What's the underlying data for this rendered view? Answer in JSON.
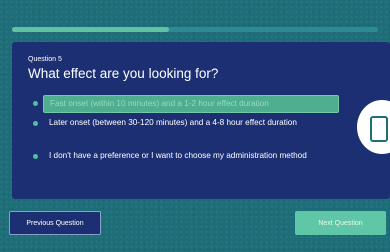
{
  "progress": {
    "fraction": 0.43
  },
  "question": {
    "number_label": "Question 5",
    "title": "What effect are you looking for?",
    "options": [
      {
        "label": "Fast onset (within 10 minutes) and a 1-2 hour effect duration",
        "selected": true
      },
      {
        "label": "Later onset (between 30-120 minutes) and a 4-8 hour effect duration",
        "selected": false
      },
      {
        "label": "I don't have a preference or I want to choose my administration method",
        "selected": false
      }
    ]
  },
  "navigation": {
    "previous_label": "Previous Question",
    "next_label": "Next Question"
  },
  "colors": {
    "background": "#1d6e78",
    "card": "#1d2f73",
    "accent": "#5ec3a5"
  },
  "icons": {
    "side_badge": "phone-icon"
  }
}
